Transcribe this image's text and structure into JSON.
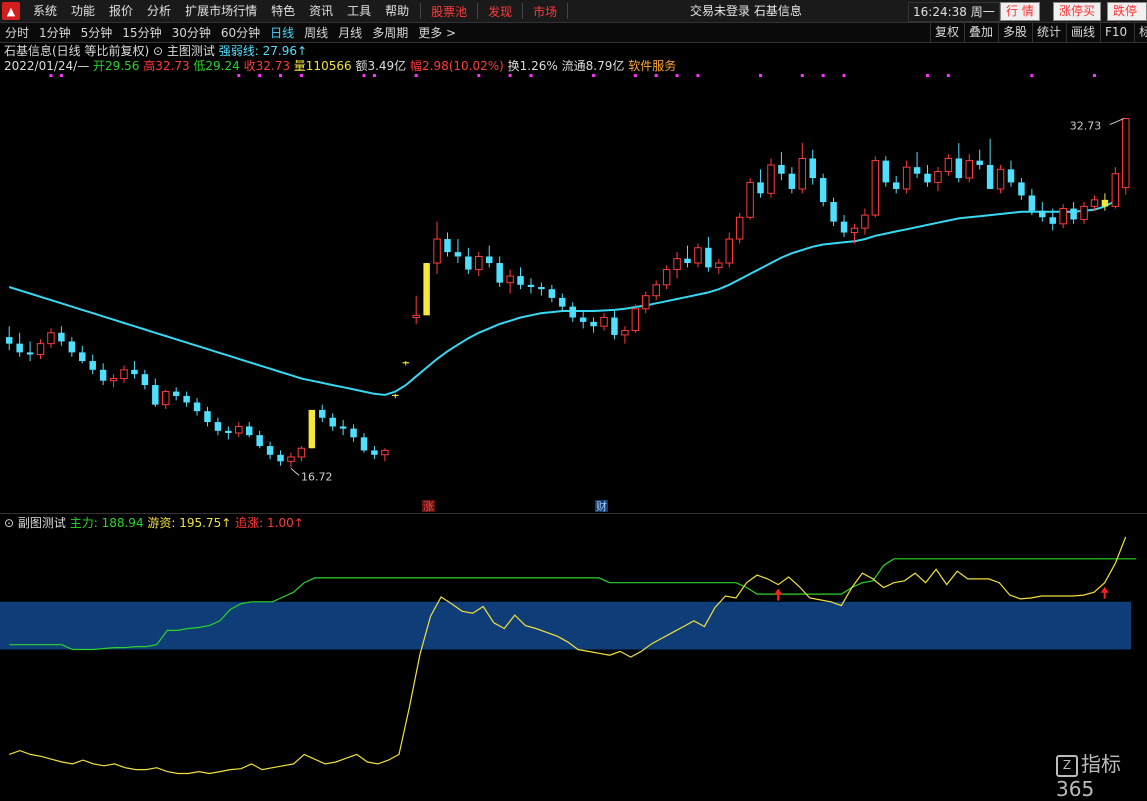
{
  "menu": {
    "items": [
      "系统",
      "功能",
      "报价",
      "分析",
      "扩展市场行情",
      "特色",
      "资讯",
      "工具",
      "帮助"
    ],
    "red_items": [
      "股票池",
      "发现",
      "市场"
    ],
    "center_text": "交易未登录  石基信息",
    "clock": "16:24:38 周一",
    "btn_market": "行  情",
    "btn_limit_up": "涨停买",
    "btn_limit_down": "跌停卖"
  },
  "period_tabs": [
    "分时",
    "1分钟",
    "5分钟",
    "15分钟",
    "30分钟",
    "60分钟",
    "日线",
    "周线",
    "月线",
    "多周期",
    "更多 >"
  ],
  "active_tab": "日线",
  "tools": [
    "复权",
    "叠加",
    "多股",
    "统计",
    "画线",
    "F10",
    "标"
  ],
  "stock_header": {
    "name": "石基信息(日线 等比前复权)",
    "indicator": "主图测试",
    "strength": "强弱线: 27.96↑",
    "date": "2022/01/24/—",
    "open": "开29.56",
    "high": "高32.73",
    "low": "低29.24",
    "close": "收32.73",
    "volume": "量110566",
    "amount": "额3.49亿",
    "change": "幅2.98(10.02%)",
    "turnover": "换1.26%",
    "float": "流通8.79亿",
    "service": "软件服务"
  },
  "main_chart": {
    "high_label": "32.73",
    "low_label": "16.72",
    "marker_zhang": "涨",
    "marker_cai": "财",
    "ylim": [
      15.5,
      34.5
    ],
    "colors": {
      "up": "#ff3b3b",
      "down": "#4fe0ff",
      "limit": "#f5e83a",
      "ma": "#39d8f2",
      "dot": "#ff30ff"
    }
  },
  "sub_chart": {
    "title": "副图测试",
    "main_force": "主力: 188.94",
    "hot_money": "游资: 195.75↑",
    "chase": "追涨: 1.00↑",
    "band_color": "#0f3d78"
  },
  "watermark": "指标365",
  "chart_data": {
    "type": "candlestick",
    "note_series": "daily OHLC, oldest to newest",
    "candles": [
      [
        22.7,
        23.2,
        22.1,
        22.4
      ],
      [
        22.4,
        22.9,
        21.8,
        22.0
      ],
      [
        22.0,
        22.5,
        21.6,
        21.9
      ],
      [
        21.9,
        22.6,
        21.7,
        22.4
      ],
      [
        22.4,
        23.1,
        22.2,
        22.9
      ],
      [
        22.9,
        23.2,
        22.3,
        22.5
      ],
      [
        22.5,
        22.7,
        21.8,
        22.0
      ],
      [
        22.0,
        22.3,
        21.5,
        21.6
      ],
      [
        21.6,
        21.9,
        21.0,
        21.2
      ],
      [
        21.2,
        21.5,
        20.5,
        20.7
      ],
      [
        20.7,
        21.0,
        20.4,
        20.8
      ],
      [
        20.8,
        21.4,
        20.6,
        21.2
      ],
      [
        21.2,
        21.6,
        20.8,
        21.0
      ],
      [
        21.0,
        21.2,
        20.3,
        20.5
      ],
      [
        20.5,
        20.8,
        19.5,
        19.6
      ],
      [
        19.6,
        20.3,
        19.4,
        20.2
      ],
      [
        20.2,
        20.4,
        19.8,
        20.0
      ],
      [
        20.0,
        20.2,
        19.5,
        19.7
      ],
      [
        19.7,
        19.9,
        19.1,
        19.3
      ],
      [
        19.3,
        19.5,
        18.6,
        18.8
      ],
      [
        18.8,
        19.0,
        18.2,
        18.4
      ],
      [
        18.4,
        18.6,
        18.0,
        18.3
      ],
      [
        18.3,
        18.8,
        18.1,
        18.6
      ],
      [
        18.6,
        18.8,
        18.1,
        18.2
      ],
      [
        18.2,
        18.4,
        17.6,
        17.7
      ],
      [
        17.7,
        17.9,
        17.1,
        17.3
      ],
      [
        17.3,
        17.5,
        16.8,
        17.0
      ],
      [
        17.0,
        17.4,
        16.72,
        17.2
      ],
      [
        17.2,
        17.7,
        17.0,
        17.6
      ],
      [
        17.6,
        19.3,
        17.6,
        19.36
      ],
      [
        19.36,
        19.6,
        18.8,
        19.0
      ],
      [
        19.0,
        19.2,
        18.4,
        18.6
      ],
      [
        18.6,
        18.9,
        18.2,
        18.5
      ],
      [
        18.5,
        18.7,
        17.9,
        18.1
      ],
      [
        18.1,
        18.3,
        17.4,
        17.5
      ],
      [
        17.5,
        17.7,
        17.1,
        17.3
      ],
      [
        17.3,
        17.6,
        17.0,
        17.5
      ],
      [
        20.0,
        20.1,
        19.9,
        20.05
      ],
      [
        21.5,
        21.6,
        21.4,
        21.55
      ],
      [
        23.6,
        24.6,
        23.3,
        23.7
      ],
      [
        23.7,
        26.1,
        23.7,
        26.1
      ],
      [
        26.1,
        28.0,
        25.6,
        27.2
      ],
      [
        27.2,
        27.5,
        26.4,
        26.6
      ],
      [
        26.6,
        27.2,
        26.1,
        26.4
      ],
      [
        26.4,
        26.8,
        25.6,
        25.8
      ],
      [
        25.8,
        26.6,
        25.5,
        26.4
      ],
      [
        26.4,
        26.9,
        25.9,
        26.1
      ],
      [
        26.1,
        26.4,
        25.0,
        25.2
      ],
      [
        25.2,
        25.8,
        24.7,
        25.5
      ],
      [
        25.5,
        25.9,
        24.9,
        25.1
      ],
      [
        25.1,
        25.4,
        24.7,
        25.0
      ],
      [
        25.0,
        25.2,
        24.6,
        24.9
      ],
      [
        24.9,
        25.1,
        24.3,
        24.5
      ],
      [
        24.5,
        24.7,
        23.9,
        24.1
      ],
      [
        24.1,
        24.3,
        23.4,
        23.6
      ],
      [
        23.6,
        23.9,
        23.1,
        23.4
      ],
      [
        23.4,
        23.6,
        22.9,
        23.2
      ],
      [
        23.2,
        23.8,
        23.0,
        23.6
      ],
      [
        23.6,
        23.9,
        22.6,
        22.8
      ],
      [
        22.8,
        23.2,
        22.4,
        23.0
      ],
      [
        23.0,
        24.2,
        22.9,
        24.0
      ],
      [
        24.0,
        24.8,
        23.8,
        24.6
      ],
      [
        24.6,
        25.3,
        24.4,
        25.1
      ],
      [
        25.1,
        26.0,
        24.9,
        25.8
      ],
      [
        25.8,
        26.6,
        25.4,
        26.3
      ],
      [
        26.3,
        26.9,
        25.9,
        26.1
      ],
      [
        26.1,
        27.0,
        25.9,
        26.8
      ],
      [
        26.8,
        27.3,
        25.7,
        25.9
      ],
      [
        25.9,
        26.3,
        25.6,
        26.1
      ],
      [
        26.1,
        27.5,
        25.9,
        27.2
      ],
      [
        27.2,
        28.4,
        27.0,
        28.2
      ],
      [
        28.2,
        30.0,
        28.1,
        29.8
      ],
      [
        29.8,
        30.4,
        29.1,
        29.3
      ],
      [
        29.3,
        30.9,
        29.1,
        30.6
      ],
      [
        30.6,
        31.2,
        29.9,
        30.2
      ],
      [
        30.2,
        30.5,
        29.3,
        29.5
      ],
      [
        29.5,
        31.6,
        29.3,
        30.9
      ],
      [
        30.9,
        31.3,
        29.7,
        30.0
      ],
      [
        30.0,
        30.2,
        28.7,
        28.9
      ],
      [
        28.9,
        29.1,
        27.8,
        28.0
      ],
      [
        28.0,
        28.3,
        27.3,
        27.5
      ],
      [
        27.5,
        27.9,
        27.0,
        27.7
      ],
      [
        27.7,
        28.6,
        27.4,
        28.3
      ],
      [
        28.3,
        31.0,
        28.2,
        30.8
      ],
      [
        30.8,
        31.0,
        29.6,
        29.8
      ],
      [
        29.8,
        30.1,
        29.3,
        29.5
      ],
      [
        29.5,
        30.8,
        29.3,
        30.5
      ],
      [
        30.5,
        31.2,
        30.0,
        30.2
      ],
      [
        30.2,
        30.6,
        29.6,
        29.8
      ],
      [
        29.8,
        30.5,
        29.4,
        30.3
      ],
      [
        30.3,
        31.1,
        30.1,
        30.9
      ],
      [
        30.9,
        31.6,
        29.8,
        30.0
      ],
      [
        30.0,
        31.1,
        29.8,
        30.8
      ],
      [
        30.8,
        31.3,
        30.4,
        30.6
      ],
      [
        30.6,
        31.8,
        30.2,
        29.5
      ],
      [
        29.5,
        30.6,
        29.3,
        30.4
      ],
      [
        30.4,
        30.8,
        29.6,
        29.8
      ],
      [
        29.8,
        30.0,
        29.0,
        29.2
      ],
      [
        29.2,
        29.5,
        28.3,
        28.5
      ],
      [
        28.5,
        28.9,
        28.0,
        28.2
      ],
      [
        28.2,
        28.6,
        27.6,
        27.9
      ],
      [
        27.9,
        28.8,
        27.7,
        28.6
      ],
      [
        28.6,
        28.9,
        27.9,
        28.1
      ],
      [
        28.1,
        28.9,
        27.9,
        28.7
      ],
      [
        28.7,
        29.2,
        28.5,
        29.0
      ],
      [
        29.0,
        29.3,
        28.5,
        28.7
      ],
      [
        28.7,
        30.5,
        28.6,
        30.2
      ],
      [
        29.56,
        32.73,
        29.24,
        32.73
      ]
    ],
    "limit_up_bars": [
      29,
      37,
      38,
      40,
      105
    ],
    "ma_values": [
      25.0,
      24.85,
      24.7,
      24.55,
      24.4,
      24.25,
      24.1,
      23.95,
      23.8,
      23.65,
      23.5,
      23.35,
      23.2,
      23.05,
      22.9,
      22.75,
      22.6,
      22.45,
      22.3,
      22.15,
      22.0,
      21.85,
      21.7,
      21.55,
      21.4,
      21.25,
      21.1,
      20.95,
      20.8,
      20.7,
      20.6,
      20.5,
      20.4,
      20.3,
      20.2,
      20.1,
      20.05,
      20.2,
      20.5,
      20.9,
      21.3,
      21.7,
      22.05,
      22.35,
      22.65,
      22.9,
      23.1,
      23.3,
      23.45,
      23.6,
      23.7,
      23.8,
      23.85,
      23.9,
      23.9,
      23.9,
      23.9,
      23.92,
      23.95,
      24.0,
      24.08,
      24.15,
      24.25,
      24.35,
      24.45,
      24.55,
      24.65,
      24.75,
      24.9,
      25.1,
      25.35,
      25.6,
      25.85,
      26.1,
      26.35,
      26.55,
      26.7,
      26.85,
      26.95,
      27.0,
      27.05,
      27.1,
      27.2,
      27.35,
      27.45,
      27.55,
      27.65,
      27.75,
      27.85,
      27.95,
      28.05,
      28.15,
      28.2,
      28.25,
      28.3,
      28.35,
      28.4,
      28.45,
      28.45,
      28.45,
      28.45,
      28.45,
      28.45,
      28.5,
      28.55,
      28.7,
      28.95
    ],
    "sub_series": {
      "ylim": [
        0,
        260
      ],
      "band": [
        140,
        190
      ],
      "main_force": [
        145,
        145,
        145,
        145,
        145,
        145,
        140,
        140,
        140,
        141,
        142,
        142,
        143,
        143,
        145,
        160,
        160,
        162,
        163,
        165,
        170,
        182,
        188,
        190,
        190,
        190,
        195,
        200,
        210,
        215,
        215,
        215,
        215,
        215,
        215,
        215,
        215,
        215,
        215,
        215,
        215,
        215,
        215,
        215,
        215,
        215,
        215,
        215,
        215,
        215,
        215,
        215,
        215,
        215,
        215,
        215,
        215,
        210,
        210,
        210,
        210,
        210,
        210,
        210,
        210,
        210,
        210,
        210,
        210,
        210,
        205,
        198,
        198,
        198,
        198,
        198,
        198,
        198,
        198,
        198,
        205,
        210,
        212,
        228,
        235,
        235,
        235,
        235,
        235,
        235,
        235,
        235,
        235,
        235,
        235,
        235,
        235,
        235,
        235,
        235,
        235,
        235,
        235,
        235,
        235,
        235,
        235,
        235
      ],
      "hot_money": [
        30,
        34,
        30,
        28,
        25,
        22,
        20,
        24,
        20,
        18,
        20,
        16,
        14,
        14,
        16,
        12,
        10,
        10,
        12,
        10,
        12,
        14,
        15,
        20,
        14,
        16,
        18,
        20,
        30,
        25,
        20,
        22,
        26,
        30,
        22,
        20,
        24,
        30,
        80,
        135,
        175,
        195,
        188,
        180,
        178,
        185,
        168,
        162,
        176,
        165,
        162,
        158,
        154,
        148,
        140,
        138,
        136,
        134,
        138,
        132,
        138,
        146,
        152,
        158,
        164,
        170,
        164,
        184,
        196,
        194,
        210,
        218,
        214,
        208,
        216,
        206,
        194,
        192,
        190,
        186,
        205,
        220,
        214,
        205,
        210,
        212,
        220,
        210,
        224,
        208,
        222,
        214,
        214,
        214,
        210,
        197,
        193,
        194,
        196,
        196,
        196,
        196,
        197,
        200,
        210,
        230,
        258
      ]
    },
    "sub_arrows": [
      73,
      104
    ]
  }
}
